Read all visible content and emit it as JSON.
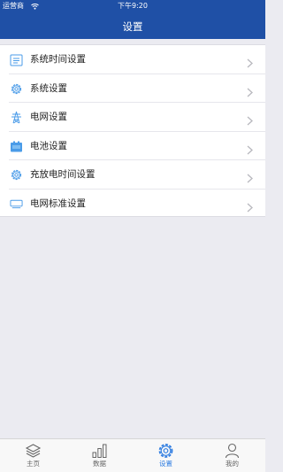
{
  "status_bar": {
    "carrier": "运营商",
    "time": "下午9:20"
  },
  "header": {
    "title": "设置"
  },
  "settings": {
    "items": [
      {
        "label": "系统时间设置",
        "icon": "calendar-icon"
      },
      {
        "label": "系统设置",
        "icon": "gear-icon"
      },
      {
        "label": "电网设置",
        "icon": "power-tower-icon"
      },
      {
        "label": "电池设置",
        "icon": "battery-icon"
      },
      {
        "label": "充放电时间设置",
        "icon": "gear-icon"
      },
      {
        "label": "电网标准设置",
        "icon": "monitor-icon"
      }
    ]
  },
  "tabbar": {
    "tabs": [
      {
        "label": "主页",
        "icon": "layers-icon",
        "active": false
      },
      {
        "label": "数据",
        "icon": "bar-chart-icon",
        "active": false
      },
      {
        "label": "设置",
        "icon": "gear-icon",
        "active": true
      },
      {
        "label": "我的",
        "icon": "user-icon",
        "active": false
      }
    ]
  },
  "colors": {
    "header_bg": "#1f50a6",
    "accent": "#2f7de1",
    "page_bg": "#ebebf1"
  }
}
